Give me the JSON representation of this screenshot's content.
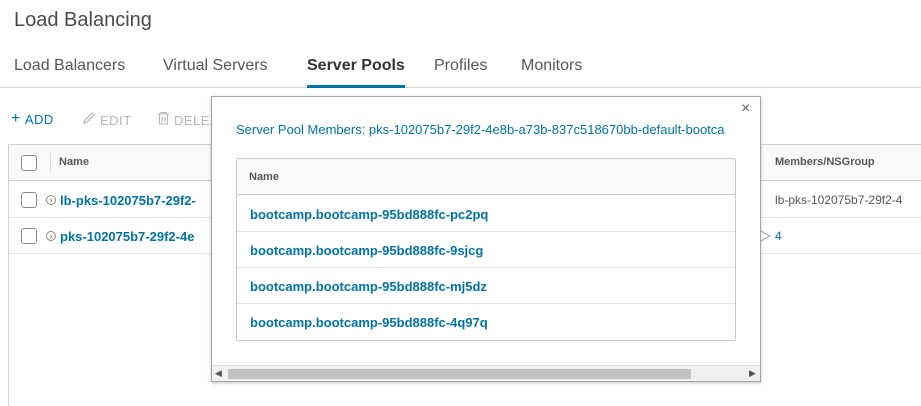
{
  "page": {
    "title": "Load Balancing"
  },
  "tabs": [
    {
      "label": "Load Balancers"
    },
    {
      "label": "Virtual Servers"
    },
    {
      "label": "Server Pools"
    },
    {
      "label": "Profiles"
    },
    {
      "label": "Monitors"
    }
  ],
  "toolbar": {
    "add_label": "ADD",
    "edit_label": "EDIT",
    "delete_label": "DELE"
  },
  "grid": {
    "columns": {
      "name": "Name",
      "members": "Members/NSGroup"
    },
    "rows": [
      {
        "name": "lb-pks-102075b7-29f2-",
        "members": "lb-pks-102075b7-29f2-4"
      },
      {
        "name": "pks-102075b7-29f2-4e",
        "members": "4"
      }
    ]
  },
  "modal": {
    "title": "Server Pool Members: pks-102075b7-29f2-4e8b-a73b-837c518670bb-default-bootca",
    "column_name": "Name",
    "members": [
      "bootcamp.bootcamp-95bd888fc-pc2pq",
      "bootcamp.bootcamp-95bd888fc-9sjcg",
      "bootcamp.bootcamp-95bd888fc-mj5dz",
      "bootcamp.bootcamp-95bd888fc-4q97q"
    ]
  },
  "colors": {
    "accent": "#0072a3",
    "disabled": "#b5b5b5"
  }
}
